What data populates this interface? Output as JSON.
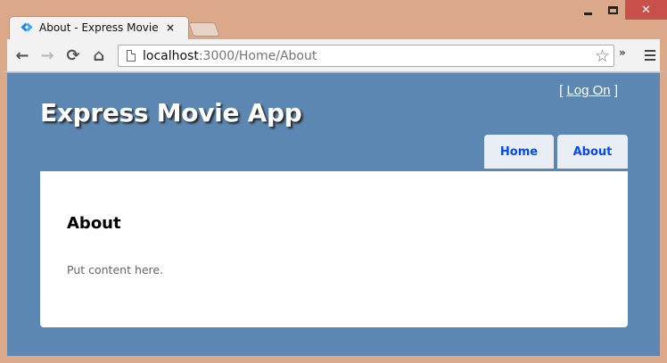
{
  "window": {
    "close_glyph": "✕"
  },
  "tabs": [
    {
      "title": "About - Express Movie App",
      "close_glyph": "×"
    }
  ],
  "toolbar": {
    "back_glyph": "←",
    "forward_glyph": "→",
    "reload_glyph": "⟳",
    "home_glyph": "⌂",
    "url_host": "localhost",
    "url_rest": ":3000/Home/About",
    "bookmark_glyph": "☆",
    "extensions_glyph": "»"
  },
  "site": {
    "login_open": "[ ",
    "login_link": "Log On",
    "login_close": " ]",
    "title": "Express Movie App",
    "menu": [
      {
        "label": "Home"
      },
      {
        "label": "About"
      }
    ],
    "content": {
      "heading": "About",
      "body": "Put content here."
    }
  },
  "colors": {
    "frame": "#dba98a",
    "page_background": "#5c87b2",
    "menu_link": "#034af3",
    "close_button": "#c7504a"
  },
  "icons": [
    "tab-favicon-icon",
    "back-arrow-icon",
    "forward-arrow-icon",
    "reload-icon",
    "home-icon",
    "page-icon",
    "star-icon",
    "chevron-double-icon",
    "hamburger-menu-icon"
  ]
}
